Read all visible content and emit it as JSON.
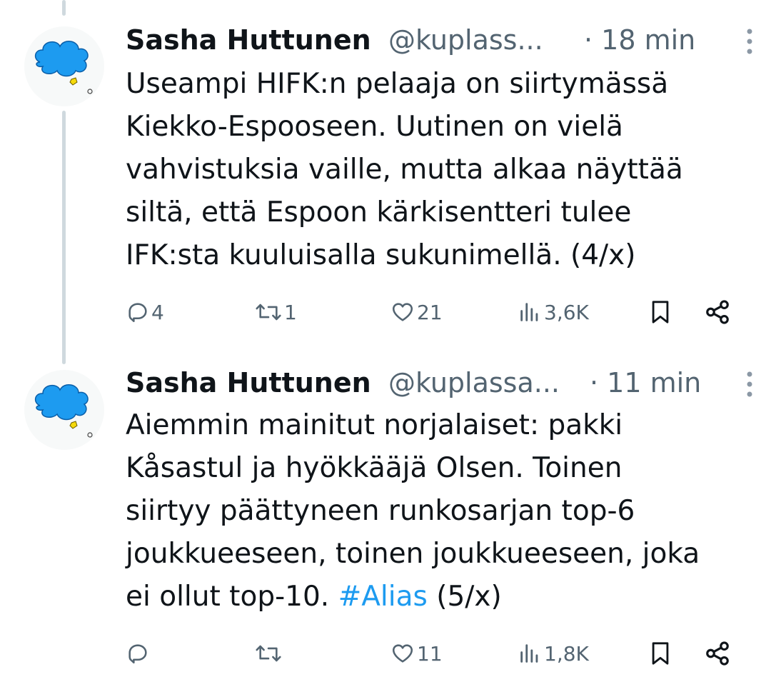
{
  "colors": {
    "accent": "#1d9bf0",
    "secondary_text": "#536471",
    "primary_text": "#0f1419",
    "thread_line": "#cfd9de"
  },
  "tweets": [
    {
      "author": {
        "name": "Sasha Huttunen",
        "handle": "@kuplass...",
        "avatar_icon": "blue-cloud-avatar"
      },
      "time": "· 18 min",
      "text_lines": [
        "Useampi HIFK:n pelaaja on siirtymässä",
        "Kiekko-Espooseen. Uutinen on vielä",
        "vahvistuksia vaille, mutta alkaa näyttää",
        "siltä, että Espoon kärkisentteri tulee",
        "IFK:sta kuuluisalla sukunimellä. (4/x)"
      ],
      "actions": {
        "replies": "4",
        "reposts": "1",
        "likes": "21",
        "views": "3,6K"
      }
    },
    {
      "author": {
        "name": "Sasha Huttunen",
        "handle": "@kuplassa...",
        "avatar_icon": "blue-cloud-avatar"
      },
      "time": "· 11 min",
      "text_lines": [
        "Aiemmin mainitut norjalaiset: pakki",
        "Kåsastul ja hyökkääjä Olsen. Toinen",
        "siirtyy päättyneen runkosarjan top-6",
        "joukkueeseen, toinen joukkueeseen, joka"
      ],
      "last_line": {
        "before": "ei ollut top-10. ",
        "hashtag": "#Alias",
        "after": " (5/x)"
      },
      "actions": {
        "replies": "",
        "reposts": "",
        "likes": "11",
        "views": "1,8K"
      }
    }
  ]
}
